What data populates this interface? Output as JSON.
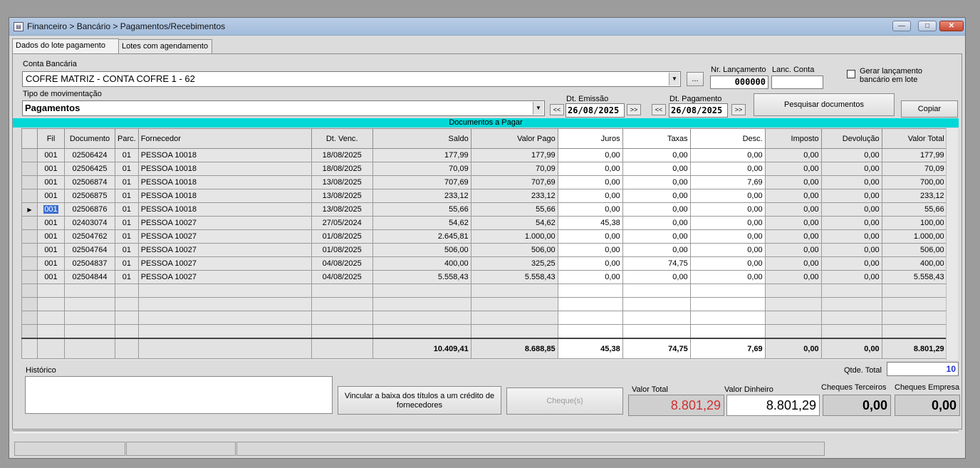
{
  "window": {
    "title": "Financeiro > Bancário > Pagamentos/Recebimentos",
    "icon": "window-app-icon"
  },
  "tabs": [
    {
      "label": "Dados do lote pagamento"
    },
    {
      "label": "Lotes com agendamento"
    }
  ],
  "conta": {
    "label": "Conta Bancária",
    "value": "COFRE MATRIZ - CONTA COFRE 1 - 62",
    "ellipsis_label": "..."
  },
  "nr_lancamento": {
    "label": "Nr. Lançamento",
    "value": "000000"
  },
  "lanc_conta": {
    "label": "Lanc. Conta",
    "value": ""
  },
  "gerar": {
    "label": "Gerar lançamento bancário em lote",
    "checked": false
  },
  "tipo": {
    "label": "Tipo de movimentação",
    "value": "Pagamentos"
  },
  "dt_emissao": {
    "label": "Dt. Emissão",
    "value": "26/08/2025",
    "prev": "<<",
    "next": ">>"
  },
  "dt_pagamento": {
    "label": "Dt. Pagamento",
    "value": "26/08/2025",
    "prev": "<<",
    "next": ">>"
  },
  "buttons": {
    "pesquisar": "Pesquisar documentos",
    "copiar": "Copiar",
    "vincular": "Vincular a baixa dos títulos a um crédito de fornecedores",
    "cheques": "Cheque(s)"
  },
  "grid": {
    "title": "Documentos a Pagar",
    "columns": [
      "Fil",
      "Documento",
      "Parc.",
      "Fornecedor",
      "Dt. Venc.",
      "Saldo",
      "Valor Pago",
      "Juros",
      "Taxas",
      "Desc.",
      "Imposto",
      "Devolução",
      "Valor Total"
    ],
    "rows": [
      [
        "001",
        "02506424",
        "01",
        "PESSOA 10018",
        "18/08/2025",
        "177,99",
        "177,99",
        "0,00",
        "0,00",
        "0,00",
        "0,00",
        "0,00",
        "177,99"
      ],
      [
        "001",
        "02506425",
        "01",
        "PESSOA 10018",
        "18/08/2025",
        "70,09",
        "70,09",
        "0,00",
        "0,00",
        "0,00",
        "0,00",
        "0,00",
        "70,09"
      ],
      [
        "001",
        "02506874",
        "01",
        "PESSOA 10018",
        "13/08/2025",
        "707,69",
        "707,69",
        "0,00",
        "0,00",
        "7,69",
        "0,00",
        "0,00",
        "700,00"
      ],
      [
        "001",
        "02506875",
        "01",
        "PESSOA 10018",
        "13/08/2025",
        "233,12",
        "233,12",
        "0,00",
        "0,00",
        "0,00",
        "0,00",
        "0,00",
        "233,12"
      ],
      [
        "001",
        "02506876",
        "01",
        "PESSOA 10018",
        "13/08/2025",
        "55,66",
        "55,66",
        "0,00",
        "0,00",
        "0,00",
        "0,00",
        "0,00",
        "55,66"
      ],
      [
        "001",
        "02403074",
        "01",
        "PESSOA 10027",
        "27/05/2024",
        "54,62",
        "54,62",
        "45,38",
        "0,00",
        "0,00",
        "0,00",
        "0,00",
        "100,00"
      ],
      [
        "001",
        "02504762",
        "01",
        "PESSOA 10027",
        "01/08/2025",
        "2.645,81",
        "1.000,00",
        "0,00",
        "0,00",
        "0,00",
        "0,00",
        "0,00",
        "1.000,00"
      ],
      [
        "001",
        "02504764",
        "01",
        "PESSOA 10027",
        "01/08/2025",
        "506,00",
        "506,00",
        "0,00",
        "0,00",
        "0,00",
        "0,00",
        "0,00",
        "506,00"
      ],
      [
        "001",
        "02504837",
        "01",
        "PESSOA 10027",
        "04/08/2025",
        "400,00",
        "325,25",
        "0,00",
        "74,75",
        "0,00",
        "0,00",
        "0,00",
        "400,00"
      ],
      [
        "001",
        "02504844",
        "01",
        "PESSOA 10027",
        "04/08/2025",
        "5.558,43",
        "5.558,43",
        "0,00",
        "0,00",
        "0,00",
        "0,00",
        "0,00",
        "5.558,43"
      ]
    ],
    "selected_row": 4,
    "current_row_marker": "▶",
    "totals": [
      "10.409,41",
      "8.688,85",
      "45,38",
      "74,75",
      "7,69",
      "0,00",
      "0,00",
      "8.801,29"
    ]
  },
  "historico": {
    "label": "Histórico",
    "value": ""
  },
  "qtde": {
    "label": "Qtde. Total",
    "value": "10"
  },
  "valor_total": {
    "label": "Valor Total",
    "value": "8.801,29",
    "color": "#d03030"
  },
  "valor_dinheiro": {
    "label": "Valor Dinheiro",
    "value": "8.801,29"
  },
  "cheques_terceiros": {
    "label": "Cheques Terceiros",
    "value": "0,00"
  },
  "cheques_empresa": {
    "label": "Cheques Empresa",
    "value": "0,00"
  }
}
